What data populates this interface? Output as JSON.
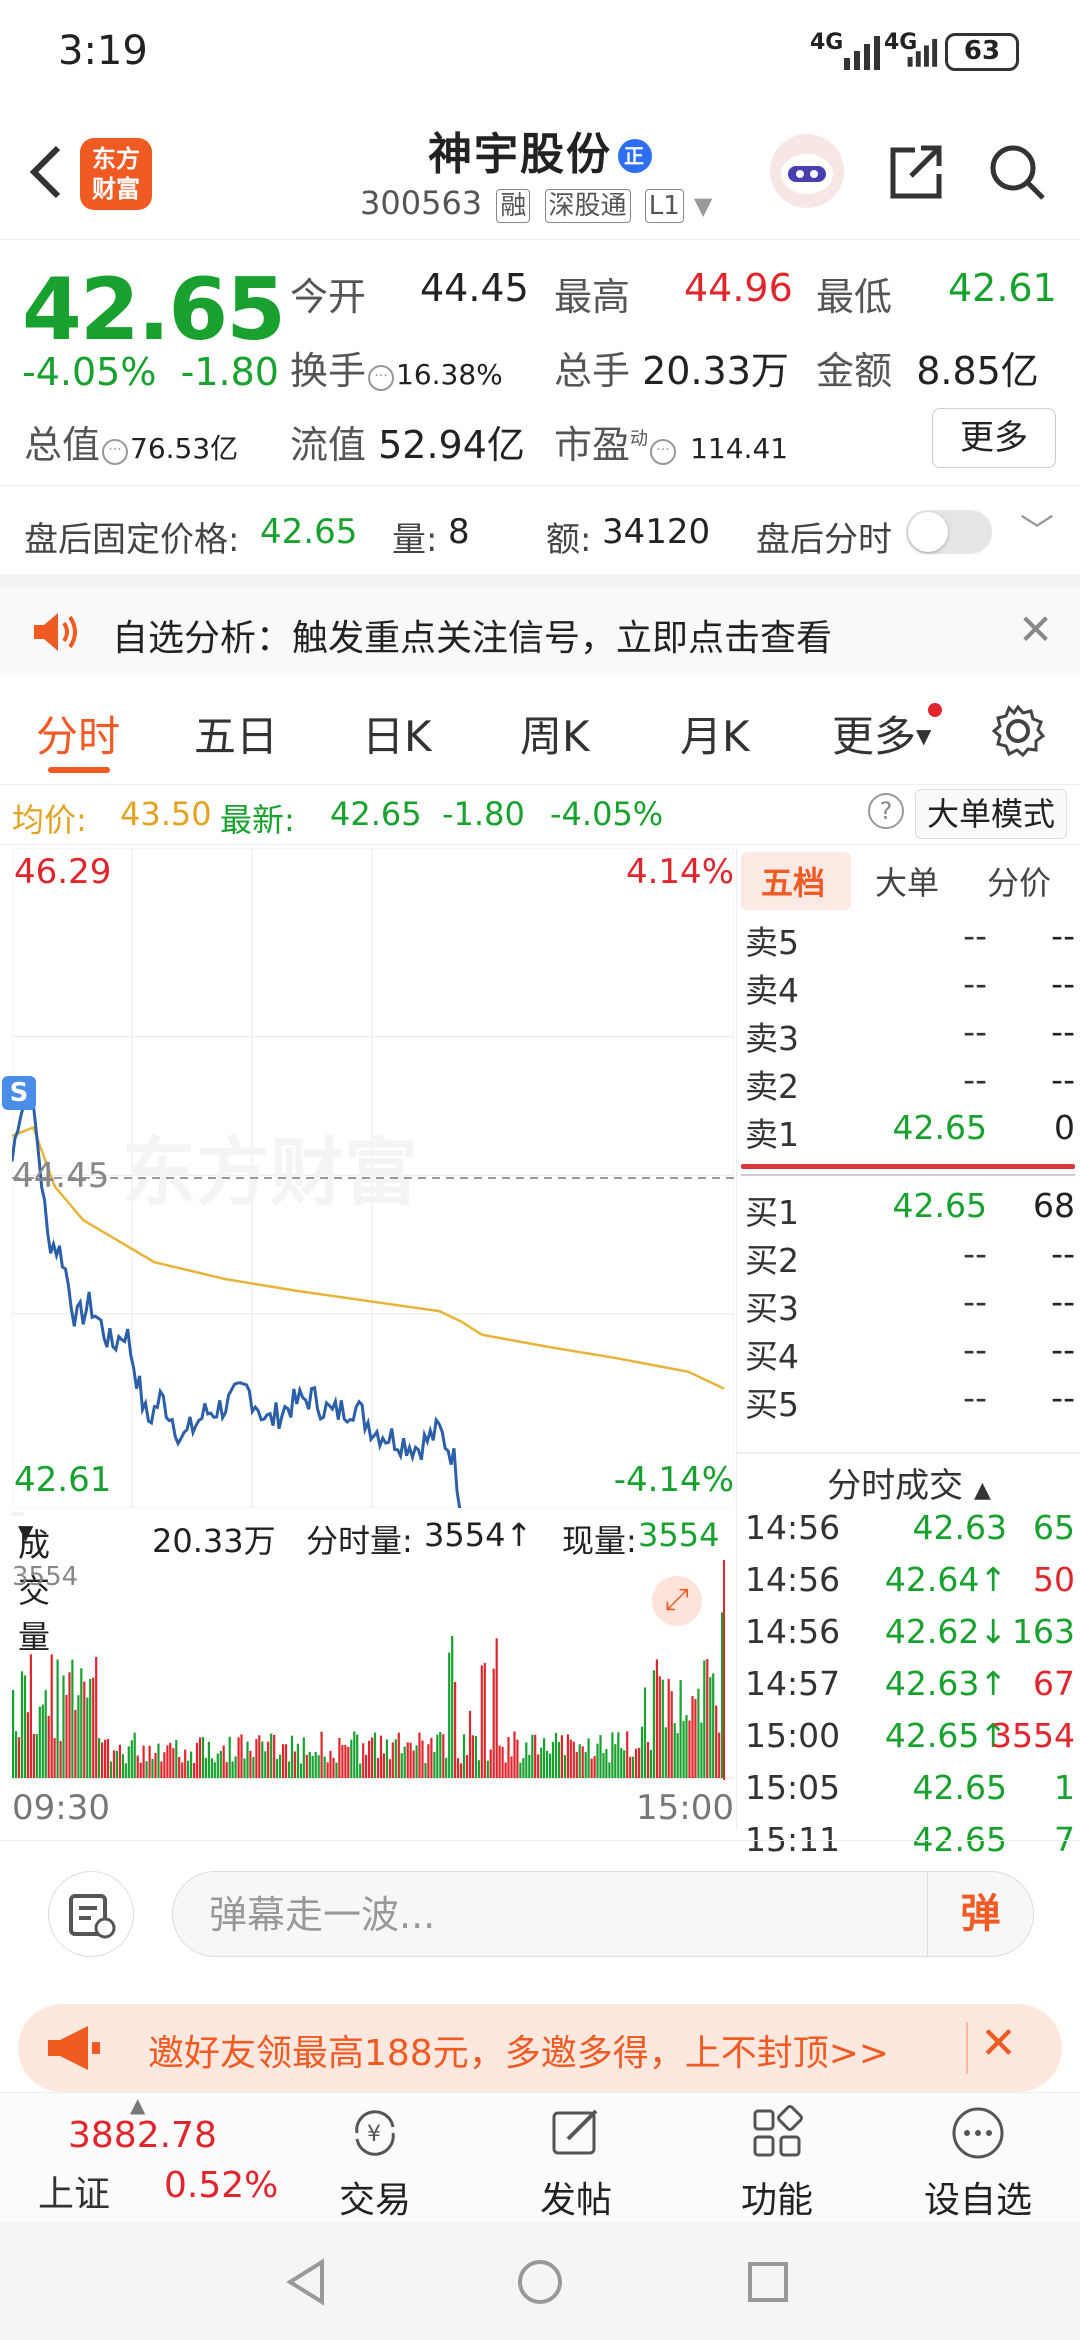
{
  "status_bar": {
    "time": "3:19",
    "network1": "4G",
    "network2": "4G",
    "battery": "63"
  },
  "header": {
    "logo_text": "东方\n财富",
    "stock_name": "神宇股份",
    "badge": "正",
    "stock_code": "300563",
    "tags": [
      "融",
      "深股通",
      "L1"
    ]
  },
  "quote": {
    "price": "42.65",
    "change_pct": "-4.05%",
    "change": "-1.80",
    "open_label": "今开",
    "open": "44.45",
    "high_label": "最高",
    "high": "44.96",
    "low_label": "最低",
    "low": "42.61",
    "turnover_label": "换手",
    "turnover": "16.38%",
    "volume_label": "总手",
    "volume": "20.33万",
    "amount_label": "金额",
    "amount": "8.85亿",
    "mktcap_label": "总值",
    "mktcap": "76.53亿",
    "float_label": "流值",
    "float_cap": "52.94亿",
    "pe_label": "市盈",
    "pe_sup": "动",
    "pe": "114.41",
    "more": "更多"
  },
  "after_hours": {
    "price_label": "盘后固定价格:",
    "price": "42.65",
    "qty_label": "量:",
    "qty": "8",
    "amt_label": "额:",
    "amt": "34120",
    "toggle_label": "盘后分时"
  },
  "alert": {
    "text": "自选分析：触发重点关注信号，立即点击查看"
  },
  "tabs": [
    "分时",
    "五日",
    "日K",
    "周K",
    "月K",
    "更多"
  ],
  "info_line": {
    "avg_label": "均价:",
    "avg": "43.50",
    "latest_label": "最新:",
    "latest": "42.65",
    "chg": "-1.80",
    "chg_pct": "-4.05%",
    "mode": "大单模式"
  },
  "chart": {
    "y_top": "46.29",
    "y_bottom": "42.61",
    "pct_top": "4.14%",
    "pct_bottom": "-4.14%",
    "ref": "44.45",
    "watermark": "东方财富",
    "s_marker": "S",
    "t_start": "09:30",
    "t_end": "15:00"
  },
  "volume": {
    "label": "成交量",
    "total": "20.33万",
    "period_label": "分时量:",
    "period": "3554↑",
    "now_label": "现量:",
    "now": "3554",
    "max": "3554"
  },
  "order_book": {
    "tabs": [
      "五档",
      "大单",
      "分价"
    ],
    "asks": [
      {
        "label": "卖5",
        "price": "--",
        "vol": "--"
      },
      {
        "label": "卖4",
        "price": "--",
        "vol": "--"
      },
      {
        "label": "卖3",
        "price": "--",
        "vol": "--"
      },
      {
        "label": "卖2",
        "price": "--",
        "vol": "--"
      },
      {
        "label": "卖1",
        "price": "42.65",
        "vol": "0"
      }
    ],
    "bids": [
      {
        "label": "买1",
        "price": "42.65",
        "vol": "68"
      },
      {
        "label": "买2",
        "price": "--",
        "vol": "--"
      },
      {
        "label": "买3",
        "price": "--",
        "vol": "--"
      },
      {
        "label": "买4",
        "price": "--",
        "vol": "--"
      },
      {
        "label": "买5",
        "price": "--",
        "vol": "--"
      }
    ],
    "ticks_title": "分时成交",
    "ticks": [
      {
        "time": "14:56",
        "price": "42.63",
        "vol": "65"
      },
      {
        "time": "14:56",
        "price": "42.64↑",
        "vol": "50"
      },
      {
        "time": "14:56",
        "price": "42.62↓",
        "vol": "163"
      },
      {
        "time": "14:57",
        "price": "42.63↑",
        "vol": "67"
      },
      {
        "time": "15:00",
        "price": "42.65↑",
        "vol": "3554"
      },
      {
        "time": "15:05",
        "price": "42.65",
        "vol": "1"
      },
      {
        "time": "15:11",
        "price": "42.65",
        "vol": "7"
      }
    ]
  },
  "comment_bar": {
    "placeholder": "弹幕走一波...",
    "dan": "弹"
  },
  "promo": {
    "text": "邀好友领最高188元，多邀多得，上不封顶>>"
  },
  "bottom_nav": {
    "index_value": "3882.78",
    "index_name": "上证",
    "index_pct": "0.52%",
    "items": [
      "交易",
      "发帖",
      "功能",
      "设自选"
    ]
  },
  "colors": {
    "up": "#e0262d",
    "down": "#18a12f",
    "avg_line": "#e8b339",
    "price_line": "#2b5fa8",
    "accent": "#f05a23"
  }
}
